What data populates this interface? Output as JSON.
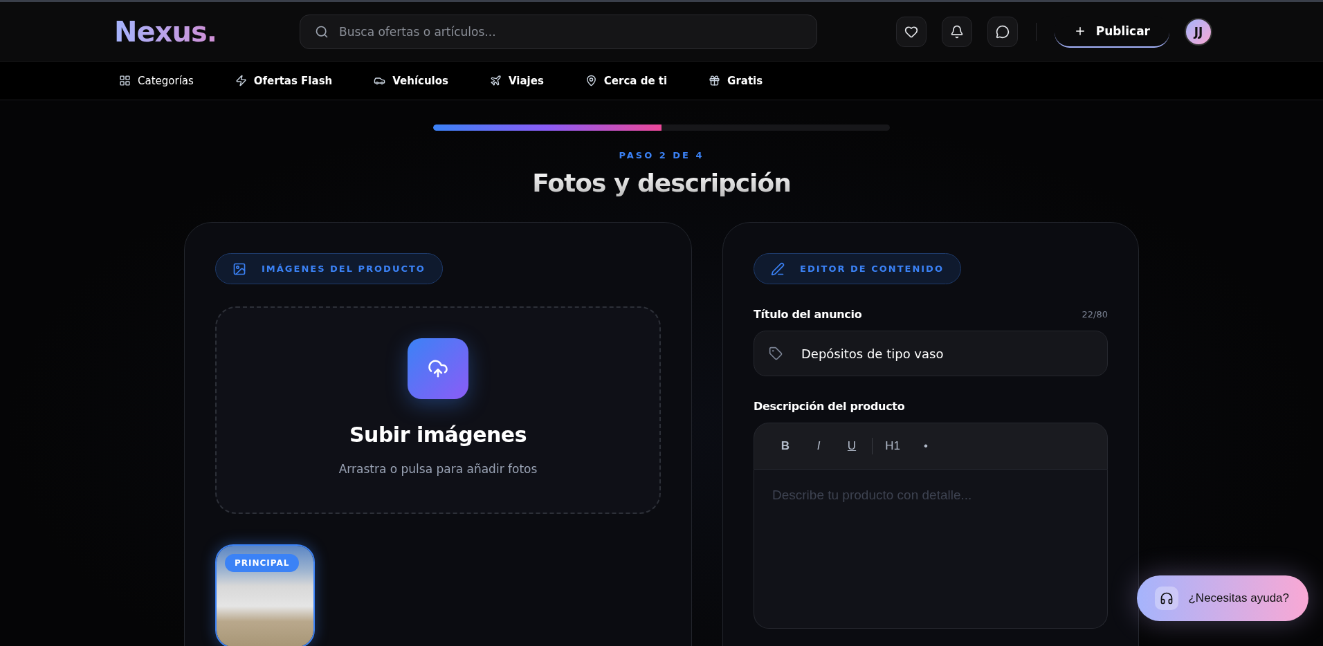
{
  "header": {
    "logo": "Nexus.",
    "search": {
      "placeholder": "Busca ofertas o artículos..."
    },
    "publish_button": "Publicar",
    "avatar": "JJ"
  },
  "nav": [
    {
      "label": "Categorías"
    },
    {
      "label": "Ofertas Flash"
    },
    {
      "label": "Vehículos"
    },
    {
      "label": "Viajes"
    },
    {
      "label": "Cerca de ti"
    },
    {
      "label": "Gratis"
    }
  ],
  "progress": {
    "level": 0.5
  },
  "step": "PASO 2 DE 4",
  "title": "Fotos y descripción",
  "images_card": {
    "badge": "IMÁGENES DEL PRODUCTO",
    "upload": {
      "title": "Subir imágenes",
      "hint": "Arrastra o pulsa para añadir fotos"
    },
    "photos": [
      {
        "tag": "PRINCIPAL"
      }
    ]
  },
  "editor_card": {
    "badge": "EDITOR DE CONTENIDO",
    "title_field": {
      "label": "Título del anuncio",
      "counter": "22/80",
      "value": "Depósitos de tipo vaso"
    },
    "description": {
      "label": "Descripción del producto",
      "toolbar_groups": [
        [
          {
            "label": "B",
            "kind": "bold"
          },
          {
            "label": "I",
            "kind": "italic"
          },
          {
            "label": "U",
            "kind": "underline"
          }
        ],
        [
          {
            "label": "H1",
            "kind": "heading"
          },
          {
            "label": "•",
            "kind": "list"
          }
        ]
      ],
      "placeholder": "Describe tu producto con detalle..."
    }
  },
  "help_button": "¿Necesitas ayuda?"
}
